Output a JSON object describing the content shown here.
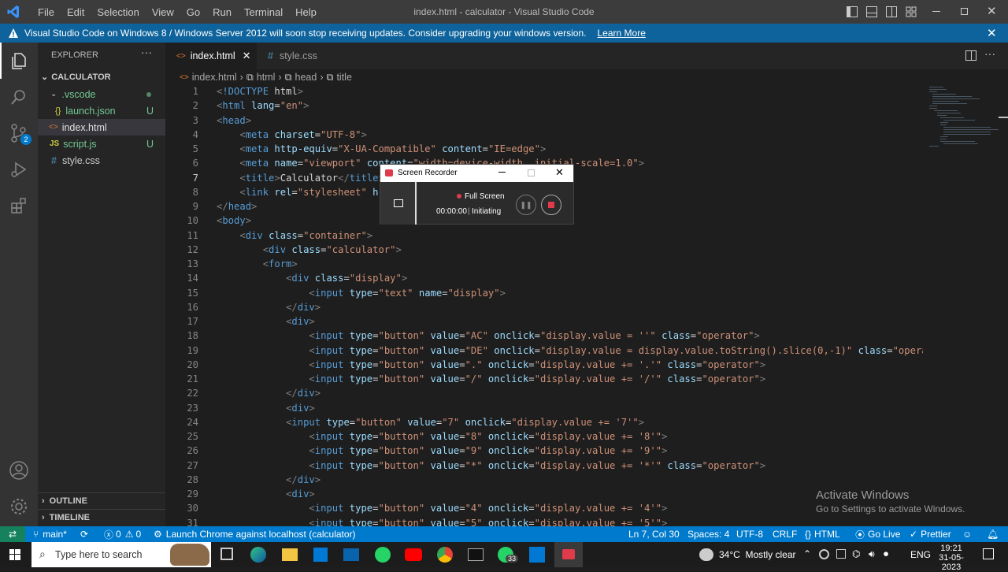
{
  "titlebar": {
    "menu": [
      "File",
      "Edit",
      "Selection",
      "View",
      "Go",
      "Run",
      "Terminal",
      "Help"
    ],
    "title": "index.html - calculator - Visual Studio Code"
  },
  "banner": {
    "text": "Visual Studio Code on Windows 8 / Windows Server 2012 will soon stop receiving updates. Consider upgrading your windows version.",
    "link": "Learn More"
  },
  "activity": {
    "scm_badge": "2"
  },
  "explorer": {
    "header": "EXPLORER",
    "folder": "CALCULATOR",
    "items": [
      {
        "name": ".vscode",
        "badge": ""
      },
      {
        "name": "launch.json",
        "badge": "U"
      },
      {
        "name": "index.html",
        "badge": ""
      },
      {
        "name": "script.js",
        "badge": "U"
      },
      {
        "name": "style.css",
        "badge": ""
      }
    ],
    "outline": "OUTLINE",
    "timeline": "TIMELINE"
  },
  "tabs": [
    {
      "label": "index.html",
      "active": true
    },
    {
      "label": "style.css",
      "active": false
    }
  ],
  "breadcrumb": [
    "index.html",
    "html",
    "head",
    "title"
  ],
  "code_lines": [
    "<!DOCTYPE html>",
    "<html lang=\"en\">",
    "<head>",
    "    <meta charset=\"UTF-8\">",
    "    <meta http-equiv=\"X-UA-Compatible\" content=\"IE=edge\">",
    "    <meta name=\"viewport\" content=\"width=device-width, initial-scale=1.0\">",
    "    <title>Calculator</title>",
    "    <link rel=\"stylesheet\" href=\"style.css\">",
    "</head>",
    "<body>",
    "    <div class=\"container\">",
    "        <div class=\"calculator\">",
    "        <form>",
    "            <div class=\"display\">",
    "                <input type=\"text\" name=\"display\">",
    "            </div>",
    "            <div>",
    "                <input type=\"button\" value=\"AC\" onclick=\"display.value = ''\" class=\"operator\">",
    "                <input type=\"button\" value=\"DE\" onclick=\"display.value = display.value.toString().slice(0,-1)\" class=\"operator\">",
    "                <input type=\"button\" value=\".\" onclick=\"display.value += '.'\" class=\"operator\">",
    "                <input type=\"button\" value=\"/\" onclick=\"display.value += '/'\" class=\"operator\">",
    "            </div>",
    "            <div>",
    "            <input type=\"button\" value=\"7\" onclick=\"display.value += '7'\">",
    "                <input type=\"button\" value=\"8\" onclick=\"display.value += '8'\">",
    "                <input type=\"button\" value=\"9\" onclick=\"display.value += '9'\">",
    "                <input type=\"button\" value=\"*\" onclick=\"display.value += '*'\" class=\"operator\">",
    "            </div>",
    "            <div>",
    "                <input type=\"button\" value=\"4\" onclick=\"display.value += '4'\">",
    "                <input type=\"button\" value=\"5\" onclick=\"display.value += '5'\">"
  ],
  "recorder": {
    "title": "Screen Recorder",
    "mode": "Full Screen",
    "time": "00:00:00",
    "state": "Initiating"
  },
  "statusbar": {
    "branch": "main*",
    "problems": "0",
    "warnings": "0",
    "launch": "Launch Chrome against localhost (calculator)",
    "position": "Ln 7, Col 30",
    "spaces": "Spaces: 4",
    "encoding": "UTF-8",
    "eol": "CRLF",
    "language": "HTML",
    "golive": "Go Live",
    "prettier": "Prettier"
  },
  "watermark": {
    "title": "Activate Windows",
    "sub": "Go to Settings to activate Windows."
  },
  "taskbar": {
    "search_placeholder": "Type here to search",
    "whatsapp_badge": "33",
    "weather": "34°C  Mostly clear",
    "lang": "ENG",
    "time": "19:21",
    "date": "31-05-2023"
  },
  "colors": {
    "accent": "#007acc",
    "banner": "#0e639c"
  }
}
